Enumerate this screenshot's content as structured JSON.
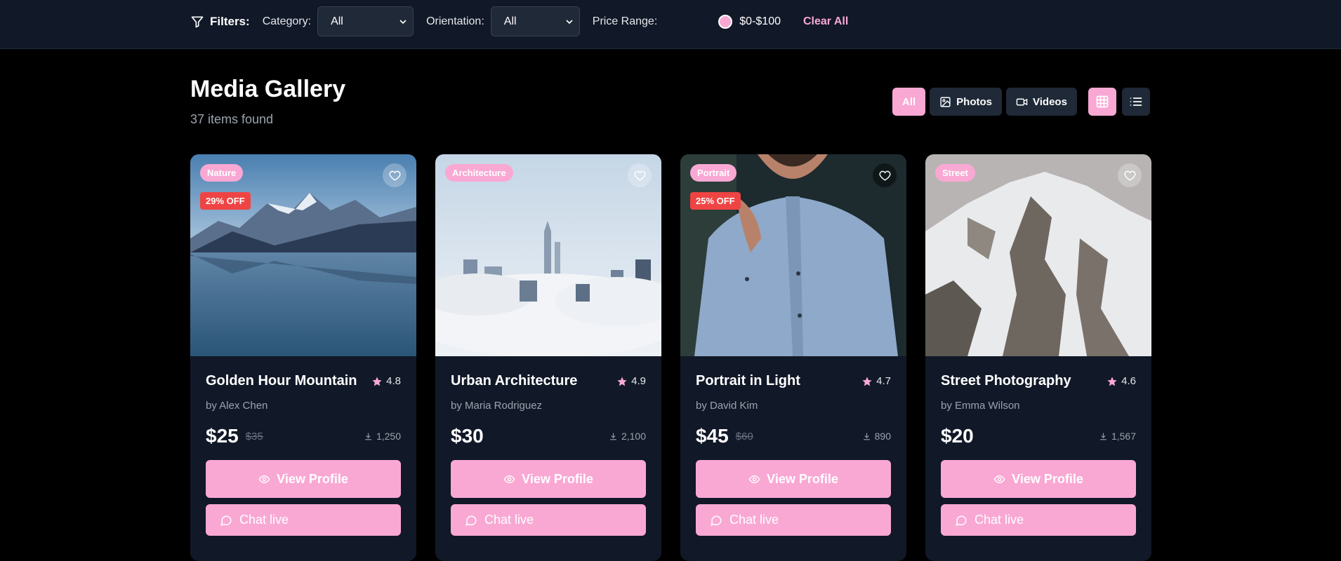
{
  "filters": {
    "title": "Filters:",
    "category_label": "Category:",
    "category_value": "All",
    "orientation_label": "Orientation:",
    "orientation_value": "All",
    "price_label": "Price Range:",
    "price_value": "$0-$100",
    "clear_label": "Clear All"
  },
  "header": {
    "title": "Media Gallery",
    "count": "37 items found"
  },
  "type_toggle": {
    "all": "All",
    "photos": "Photos",
    "videos": "Videos"
  },
  "colors": {
    "accent": "#f9a8d4",
    "discount": "#ef4444",
    "card_bg": "#111827"
  },
  "cards": [
    {
      "category": "Nature",
      "discount": "29% OFF",
      "title": "Golden Hour Mountain",
      "rating": "4.8",
      "author": "by Alex Chen",
      "price": "$25",
      "old_price": "$35",
      "downloads": "1,250",
      "view_label": "View Profile",
      "chat_label": "Chat live"
    },
    {
      "category": "Architecture",
      "discount": "",
      "title": "Urban Architecture",
      "rating": "4.9",
      "author": "by Maria Rodriguez",
      "price": "$30",
      "old_price": "",
      "downloads": "2,100",
      "view_label": "View Profile",
      "chat_label": "Chat live"
    },
    {
      "category": "Portrait",
      "discount": "25% OFF",
      "title": "Portrait in Light",
      "rating": "4.7",
      "author": "by David Kim",
      "price": "$45",
      "old_price": "$60",
      "downloads": "890",
      "view_label": "View Profile",
      "chat_label": "Chat live"
    },
    {
      "category": "Street",
      "discount": "",
      "title": "Street Photography",
      "rating": "4.6",
      "author": "by Emma Wilson",
      "price": "$20",
      "old_price": "",
      "downloads": "1,567",
      "view_label": "View Profile",
      "chat_label": "Chat live"
    }
  ]
}
